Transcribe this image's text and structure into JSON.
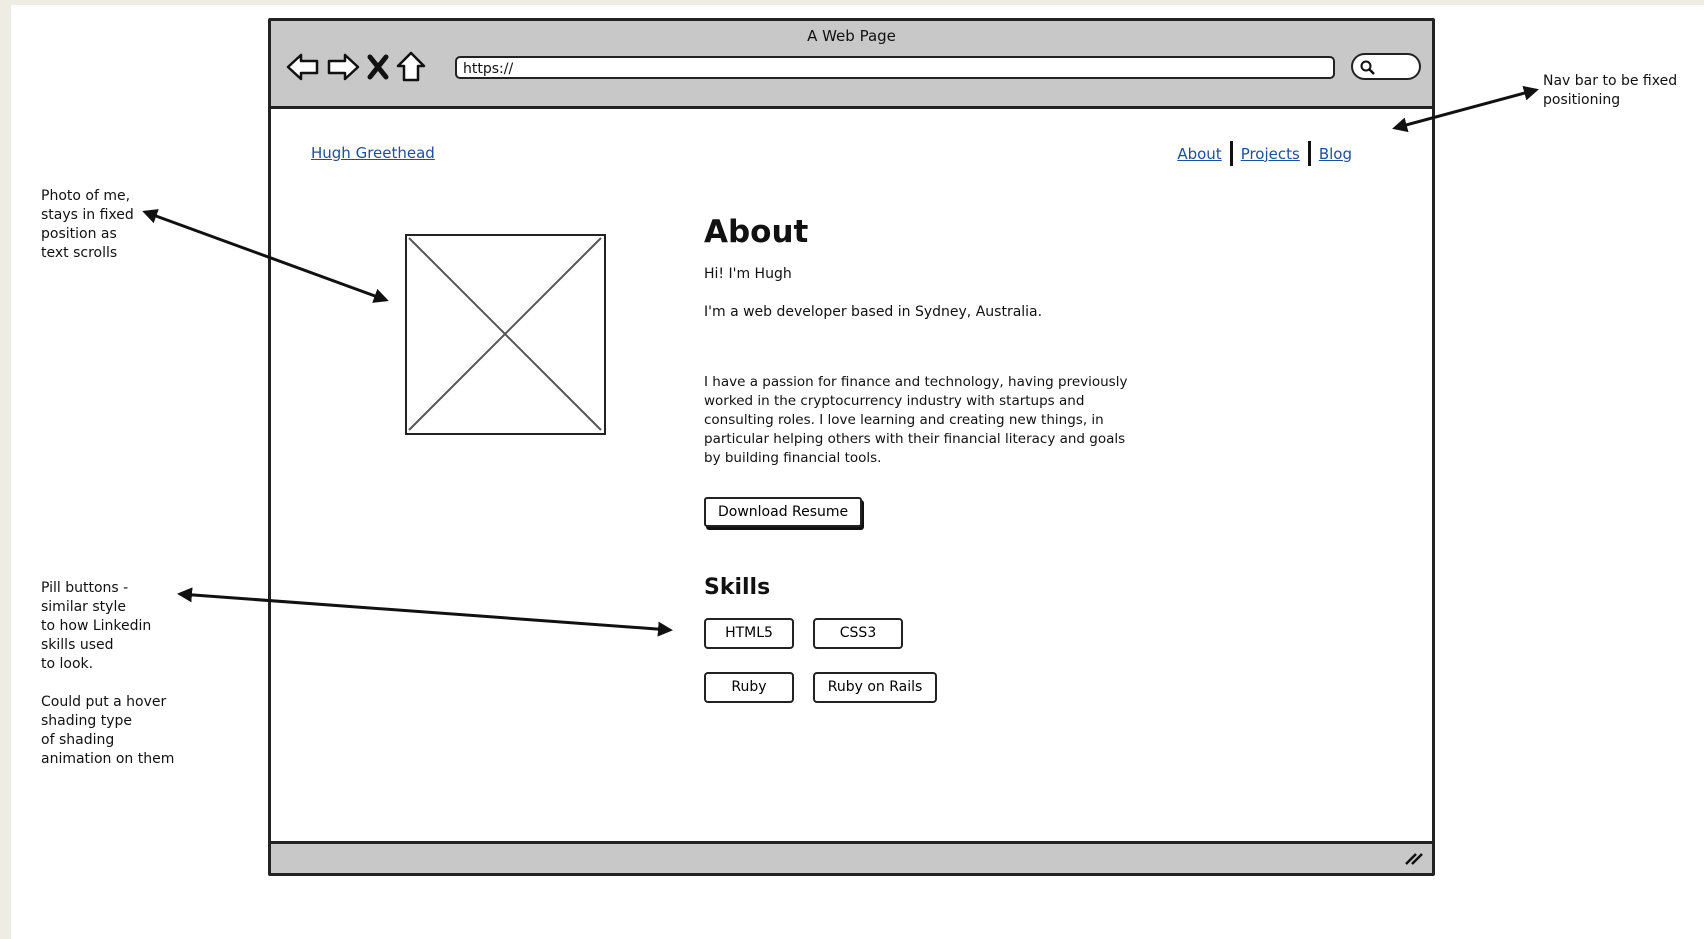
{
  "browser": {
    "title": "A Web Page",
    "url": "https://"
  },
  "site": {
    "name": "Hugh Greethead",
    "nav": [
      "About",
      "Projects",
      "Blog"
    ]
  },
  "about": {
    "title": "About",
    "greeting": "Hi! I'm Hugh",
    "location": "I'm a web developer based in Sydney, Australia.",
    "bio": "I have a passion for finance and technology, having previously worked in the cryptocurrency industry with startups and consulting roles. I love learning and creating new things, in particular helping others with their financial literacy and goals by building financial tools.",
    "resume_button": "Download Resume"
  },
  "skills": {
    "title": "Skills",
    "items": [
      "HTML5",
      "CSS3",
      "Ruby",
      "Ruby on Rails"
    ]
  },
  "annotations": {
    "nav_bar": "Nav bar to be fixed\npositioning",
    "photo": "Photo of me,\nstays in fixed\nposition as\ntext scrolls",
    "pills": "Pill buttons -\nsimilar style\nto how Linkedin\nskills used\nto look.\n\nCould put a hover\nshading type\nof shading\nanimation on them"
  },
  "icons": [
    "back-arrow-icon",
    "forward-arrow-icon",
    "close-icon",
    "home-icon",
    "search-icon",
    "resize-grip-icon",
    "image-placeholder-icon"
  ]
}
